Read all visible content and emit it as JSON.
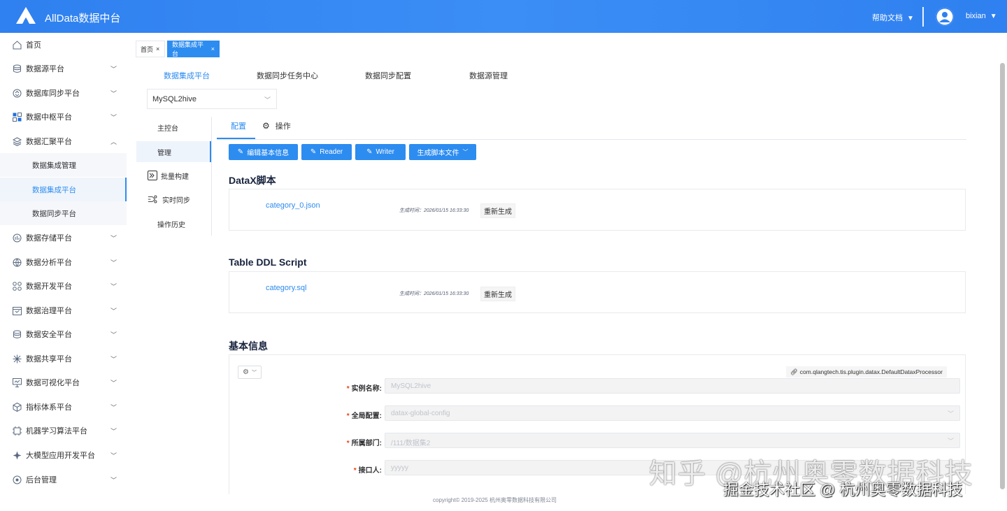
{
  "header": {
    "app_title": "AllData数据中台",
    "help_label": "帮助文档",
    "username": "bixian",
    "accent": "#2f80f0"
  },
  "sidebar": {
    "items": [
      {
        "label": "首页",
        "icon": "home-icon"
      },
      {
        "label": "数据源平台",
        "icon": "database-icon"
      },
      {
        "label": "数据库同步平台",
        "icon": "sync-icon"
      },
      {
        "label": "数据中枢平台",
        "icon": "grid-icon"
      },
      {
        "label": "数据汇聚平台",
        "icon": "layers-icon"
      },
      {
        "label": "数据存储平台",
        "icon": "storage-icon"
      },
      {
        "label": "数据分析平台",
        "icon": "analysis-icon"
      },
      {
        "label": "数据开发平台",
        "icon": "apps-icon"
      },
      {
        "label": "数据治理平台",
        "icon": "calendar-icon"
      },
      {
        "label": "数据安全平台",
        "icon": "security-icon"
      },
      {
        "label": "数据共享平台",
        "icon": "share-icon"
      },
      {
        "label": "数据可视化平台",
        "icon": "monitor-icon"
      },
      {
        "label": "指标体系平台",
        "icon": "cube-icon"
      },
      {
        "label": "机器学习算法平台",
        "icon": "ml-icon"
      },
      {
        "label": "大模型应用开发平台",
        "icon": "llm-icon"
      },
      {
        "label": "后台管理",
        "icon": "admin-icon"
      }
    ],
    "sub_items": [
      {
        "label": "数据集成管理"
      },
      {
        "label": "数据集成平台"
      },
      {
        "label": "数据同步平台"
      }
    ]
  },
  "tags": [
    {
      "label": "首页"
    },
    {
      "label": "数据集成平台"
    }
  ],
  "top_nav": [
    {
      "label": "数据集成平台"
    },
    {
      "label": "数据同步任务中心"
    },
    {
      "label": "数据同步配置"
    },
    {
      "label": "数据源管理"
    }
  ],
  "pipeline_select": {
    "value": "MySQL2hive"
  },
  "left_menu": [
    {
      "label": "主控台"
    },
    {
      "label": "管理"
    },
    {
      "label": "批量构建"
    },
    {
      "label": "实时同步"
    },
    {
      "label": "操作历史"
    }
  ],
  "inner_tabs": [
    {
      "label": "配置"
    },
    {
      "label": "操作"
    }
  ],
  "buttons": {
    "edit_basic": "编辑基本信息",
    "reader": "Reader",
    "writer": "Writer",
    "gen_script": "生成脚本文件"
  },
  "datax": {
    "title": "DataX脚本",
    "file": "category_0.json",
    "gen_time": "生成时间：2026/01/15 16:33:30",
    "regen": "重新生成"
  },
  "ddl": {
    "title": "Table DDL Script",
    "file": "category.sql",
    "gen_time": "生成时间：2026/01/15 16:33:30",
    "regen": "重新生成"
  },
  "basic_info": {
    "title": "基本信息",
    "processor": "com.qlangtech.tis.plugin.datax.DefaultDataxProcessor",
    "fields": [
      {
        "label": "实例名称:",
        "value": "MySQL2hive"
      },
      {
        "label": "全局配置:",
        "value": "datax-global-config"
      },
      {
        "label": "所属部门:",
        "value": "/111/数据集2"
      },
      {
        "label": "接口人:",
        "value": "yyyyy"
      }
    ]
  },
  "footer": "copyright© 2019-2025 杭州奥零数据科技有限公司",
  "watermark": {
    "line1": "知乎 @杭州奥零数据科技",
    "line2": "掘金技术社区 @ 杭州奥零数据科技"
  }
}
